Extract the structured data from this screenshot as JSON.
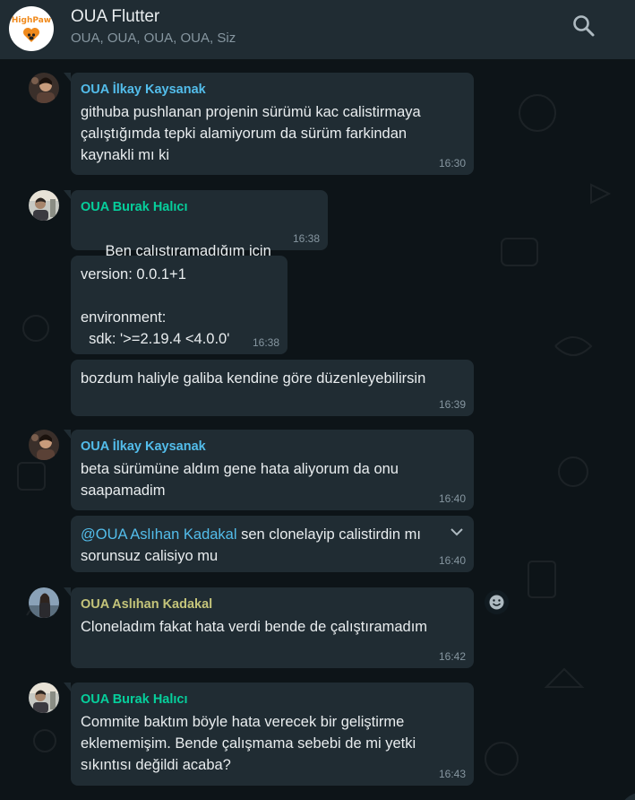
{
  "header": {
    "logo_text": "HighPaw",
    "title": "OUA Flutter",
    "subtitle": "OUA, OUA, OUA, OUA, Siz",
    "search_icon": "search-icon"
  },
  "colors": {
    "ilkay": "#53bdeb",
    "burak": "#06cf9c",
    "aslihan": "#c4c47a",
    "bubble": "#202c33",
    "timestamp": "#8696a0"
  },
  "messages": [
    {
      "sender": "OUA İlkay Kaysanak",
      "text": "githuba pushlanan projenin sürümü kac calistirmaya\nçalıştığımda tepki alamiyorum da sürüm farkindan\nkaynakli mı ki",
      "time": "16:30"
    },
    {
      "sender": "OUA Burak Halıcı",
      "text": "Ben çalıştıramadığım için",
      "emoji": "☹️",
      "time": "16:38"
    },
    {
      "text": "version: 0.0.1+1\n\nenvironment:\n  sdk: '>=2.19.4 <4.0.0'",
      "time": "16:38"
    },
    {
      "text": "bozdum haliyle galiba kendine göre düzenleyebilirsin",
      "time": "16:39"
    },
    {
      "sender": "OUA İlkay Kaysanak",
      "text": "beta sürümüne aldım gene hata aliyorum da onu\nsaapamadim",
      "time": "16:40"
    },
    {
      "mention": "@OUA Aslıhan Kadakal",
      "text_after_mention": " sen clonelayip calistirdin mı",
      "text_line2": "sorunsuz calisiyo mu",
      "time": "16:40"
    },
    {
      "sender": "OUA Aslıhan Kadakal",
      "text": "Cloneladım fakat hata verdi bende de çalıştıramadım",
      "time": "16:42"
    },
    {
      "sender": "OUA Burak Halıcı",
      "text": "Commite baktım böyle hata verecek bir geliştirme\neklememişim. Bende çalışmama sebebi de mi yetki\nsıkıntısı değildi acaba?",
      "time": "16:43"
    }
  ]
}
